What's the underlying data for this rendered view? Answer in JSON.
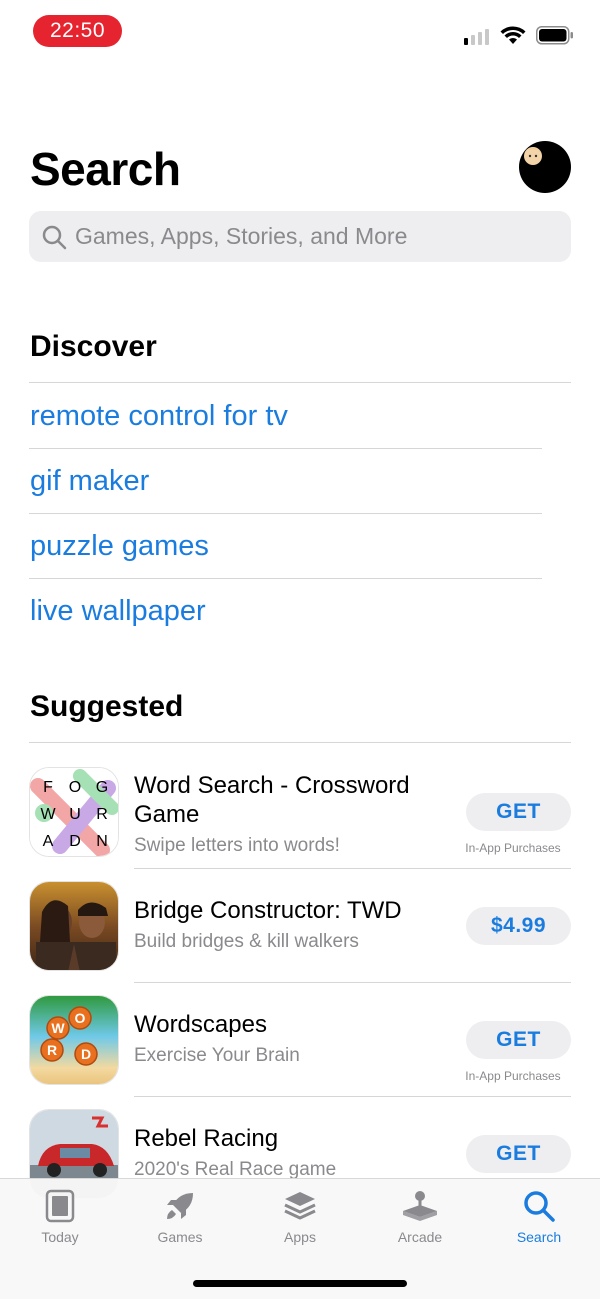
{
  "status": {
    "time": "22:50"
  },
  "header": {
    "title": "Search"
  },
  "search": {
    "placeholder": "Games, Apps, Stories, and More"
  },
  "discover": {
    "title": "Discover",
    "items": [
      {
        "label": "remote control for tv"
      },
      {
        "label": "gif maker"
      },
      {
        "label": "puzzle games"
      },
      {
        "label": "live wallpaper"
      }
    ]
  },
  "suggested": {
    "title": "Suggested",
    "apps": [
      {
        "name": "Word Search - Crossword Game",
        "subtitle": "Swipe letters into words!",
        "action": "GET",
        "note": "In-App Purchases",
        "icon": "word-search-icon"
      },
      {
        "name": "Bridge Constructor: TWD",
        "subtitle": "Build bridges & kill walkers",
        "action": "$4.99",
        "note": "",
        "icon": "bridge-constructor-icon"
      },
      {
        "name": "Wordscapes",
        "subtitle": "Exercise Your Brain",
        "action": "GET",
        "note": "In-App Purchases",
        "icon": "wordscapes-icon"
      },
      {
        "name": "Rebel Racing",
        "subtitle": "2020's Real Race game",
        "action": "GET",
        "note": "",
        "icon": "rebel-racing-icon"
      }
    ],
    "word_search_letters": [
      "F",
      "O",
      "G",
      "W",
      "U",
      "R",
      "A",
      "D",
      "N"
    ]
  },
  "tabs": [
    {
      "label": "Today",
      "icon": "today-icon",
      "active": false
    },
    {
      "label": "Games",
      "icon": "rocket-icon",
      "active": false
    },
    {
      "label": "Apps",
      "icon": "layers-icon",
      "active": false
    },
    {
      "label": "Arcade",
      "icon": "joystick-icon",
      "active": false
    },
    {
      "label": "Search",
      "icon": "search-icon",
      "active": true
    }
  ],
  "colors": {
    "accent": "#1a7cde",
    "time_pill": "#e5242f",
    "secondary_text": "#8a8a8e"
  }
}
